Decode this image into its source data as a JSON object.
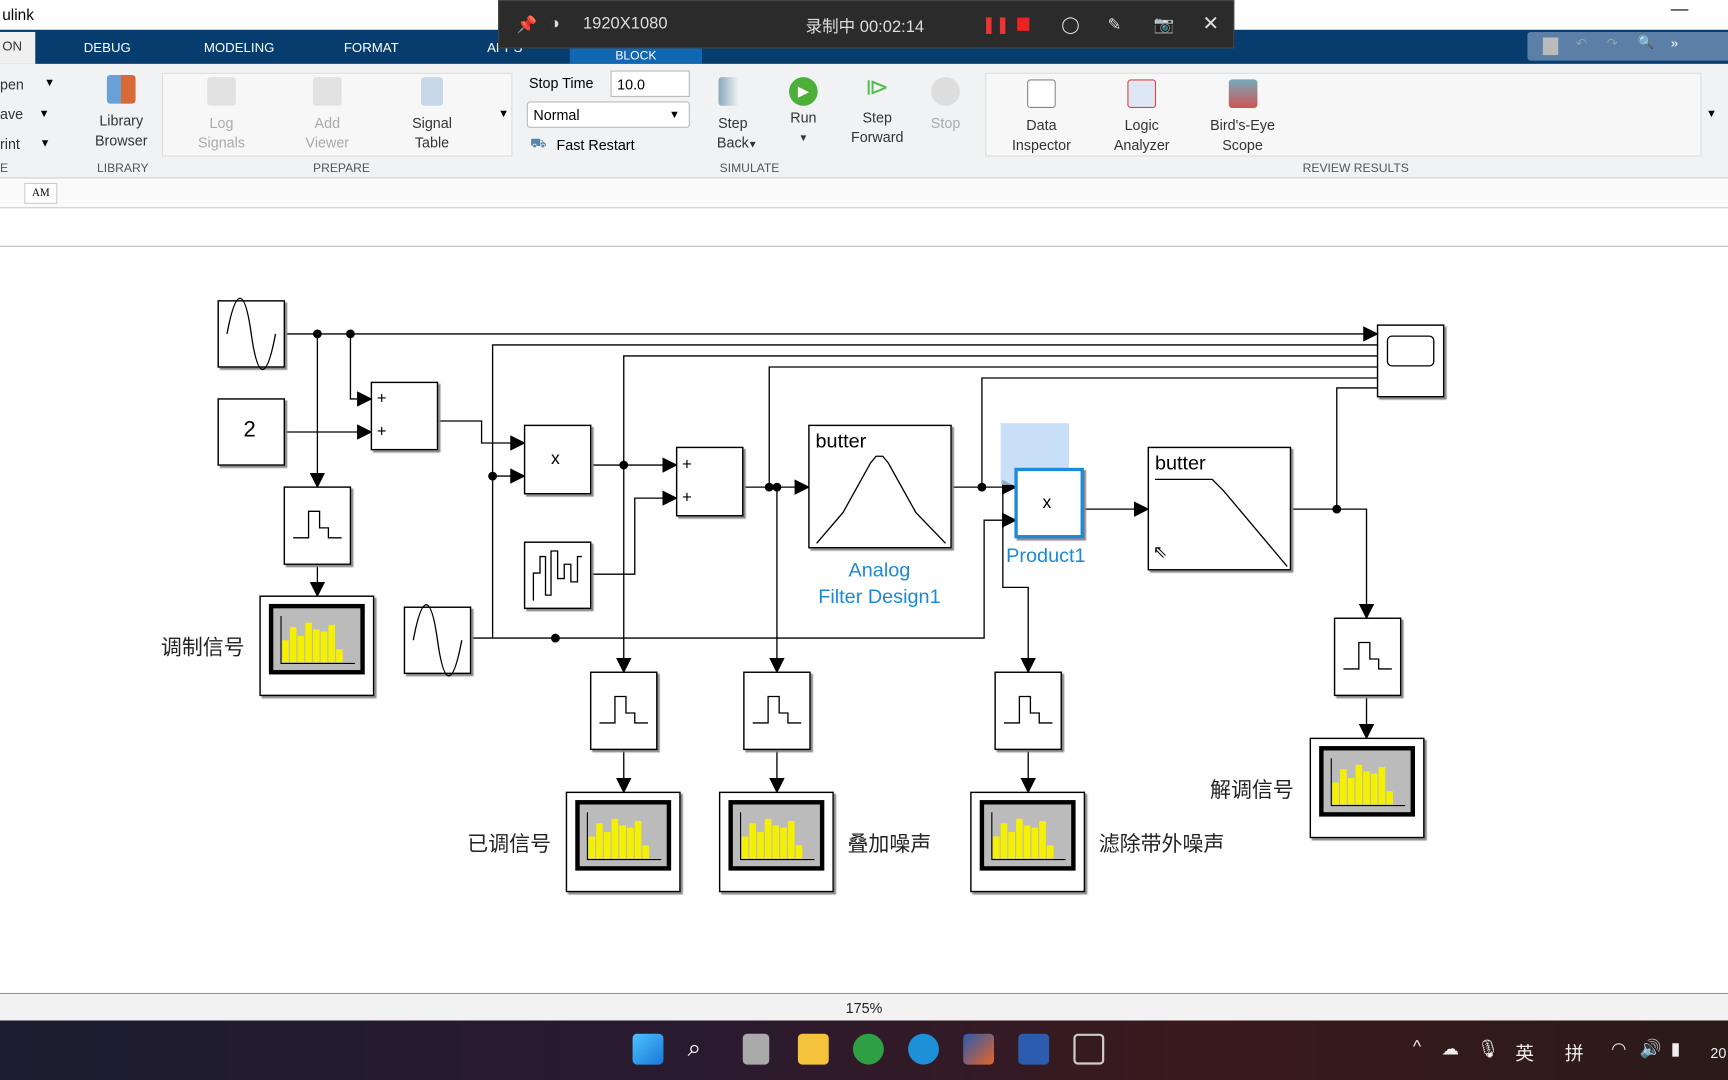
{
  "window": {
    "title": "ulink",
    "minimize": "—"
  },
  "tabs": [
    {
      "label": "ON",
      "active": true
    },
    {
      "label": "DEBUG"
    },
    {
      "label": "MODELING"
    },
    {
      "label": "FORMAT"
    },
    {
      "label": "APPS"
    },
    {
      "label": "BLOCK"
    }
  ],
  "recorder": {
    "resolution": "1920X1080",
    "status": "录制中 00:02:14"
  },
  "ribbon": {
    "file": {
      "items": [
        "pen",
        "ave",
        "rint"
      ],
      "section": "E"
    },
    "library": {
      "button": "Library Browser",
      "section": "LIBRARY"
    },
    "prepare": {
      "log": "Log Signals",
      "add": "Add Viewer",
      "table": "Signal Table",
      "section": "PREPARE"
    },
    "simulate": {
      "stop_time_label": "Stop Time",
      "stop_time": "10.0",
      "mode": "Normal",
      "fast_restart": "Fast Restart",
      "step_back": "Step Back",
      "run": "Run",
      "step_forward": "Step Forward",
      "stop": "Stop",
      "section": "SIMULATE"
    },
    "review": {
      "data_inspector": "Data Inspector",
      "logic_analyzer": "Logic Analyzer",
      "birds_eye": "Bird's-Eye Scope",
      "section": "REVIEW RESULTS"
    }
  },
  "breadcrumb": {
    "model": "AM"
  },
  "diagram": {
    "constant_value": "2",
    "product_symbol": "x",
    "sum_sign": "+",
    "filter1": {
      "title": "butter",
      "label_line1": "Analog",
      "label_line2": "Filter Design1"
    },
    "product1": {
      "label": "Product1"
    },
    "filter2": {
      "title": "butter"
    },
    "labels": {
      "modulating": "调制信号",
      "modulated": "已调信号",
      "noise": "叠加噪声",
      "filtered": "滤除带外噪声",
      "demodulated": "解调信号"
    },
    "accent": "#1a8ad4"
  },
  "status": {
    "zoom": "175%"
  },
  "taskbar": {
    "ime1": "英",
    "ime2": "拼",
    "clock": "20"
  }
}
